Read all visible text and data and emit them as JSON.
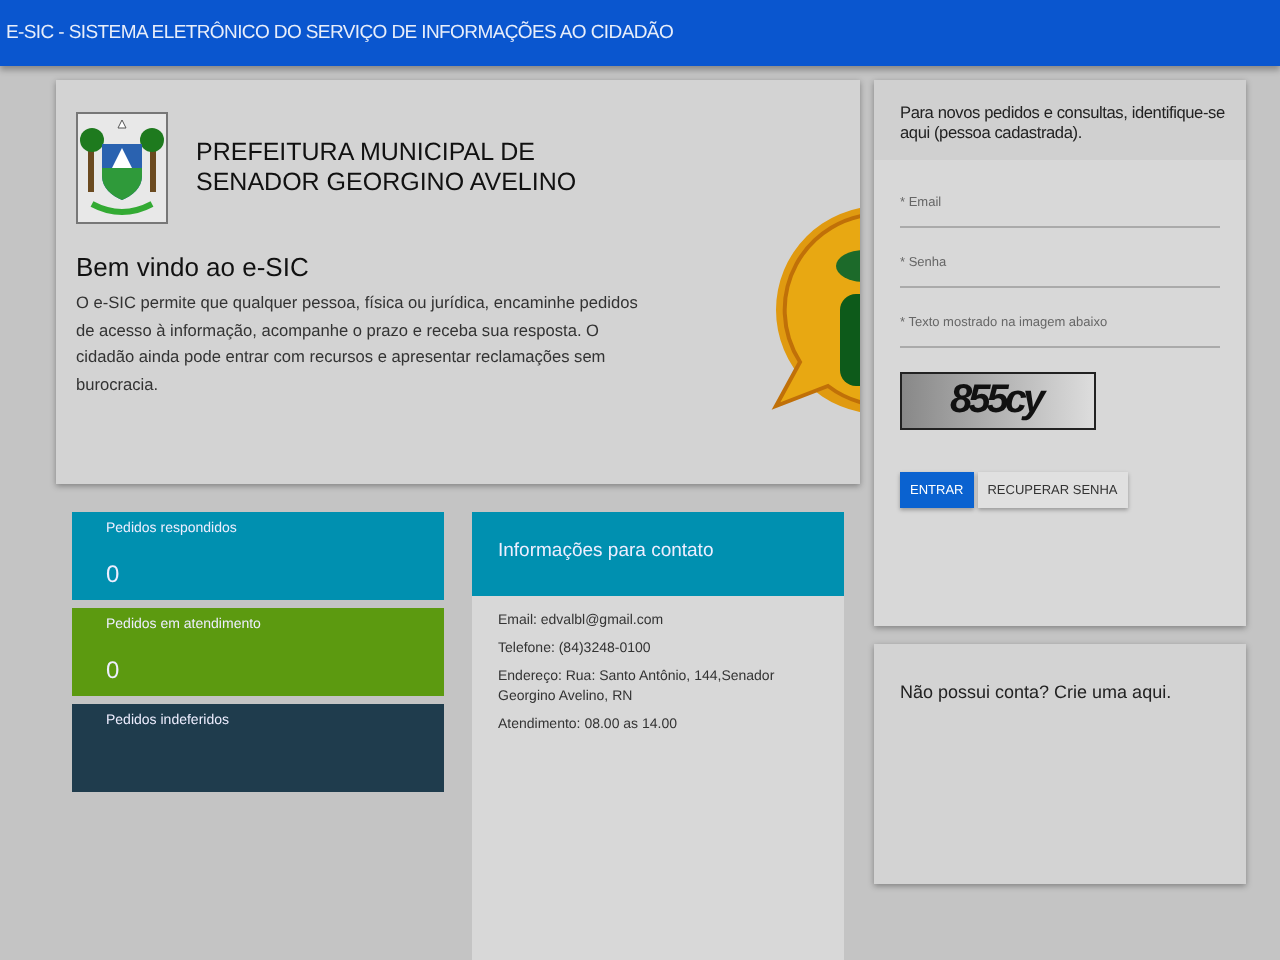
{
  "header": {
    "title": "E-SIC - SISTEMA ELETRÔNICO DO SERVIÇO DE INFORMAÇÕES AO CIDADÃO"
  },
  "welcome": {
    "org_name": [
      "PREFEITURA MUNICIPAL DE",
      "SENADOR GEORGINO AVELINO"
    ],
    "title": "Bem vindo ao e-SIC",
    "text": "O e-SIC permite que qualquer pessoa, física ou jurídica, encaminhe pedidos de acesso à informação, acompanhe o prazo e receba sua resposta. O cidadão ainda pode entrar com recursos e apresentar reclamações sem burocracia."
  },
  "stats": [
    {
      "label": "Pedidos respondidos",
      "value": "0",
      "color": "#0090b0"
    },
    {
      "label": "Pedidos em atendimento",
      "value": "0",
      "color": "#5c9a10"
    },
    {
      "label": "Pedidos indeferidos",
      "color": "#1f3c4d"
    }
  ],
  "contact": {
    "title": "Informações para contato",
    "lines": [
      "Email: edvalbl@gmail.com",
      "Telefone: (84)3248-0100",
      "Endereço: Rua: Santo Antônio, 144,Senador Georgino Avelino, RN",
      "Atendimento: 08.00 as 14.00"
    ]
  },
  "login": {
    "prompt": "Para novos pedidos e consultas, identifique-se aqui (pessoa cadastrada).",
    "fields": [
      {
        "placeholder": "* Email"
      },
      {
        "placeholder": "* Senha"
      },
      {
        "placeholder": "* Texto mostrado na imagem abaixo"
      }
    ],
    "captcha_text": "855cy",
    "buttons": [
      {
        "label": "ENTRAR",
        "kind": "primary"
      },
      {
        "label": "RECUPERAR SENHA",
        "kind": "secondary"
      }
    ]
  },
  "signup": {
    "prompt": "Não possui conta? Crie uma aqui."
  }
}
